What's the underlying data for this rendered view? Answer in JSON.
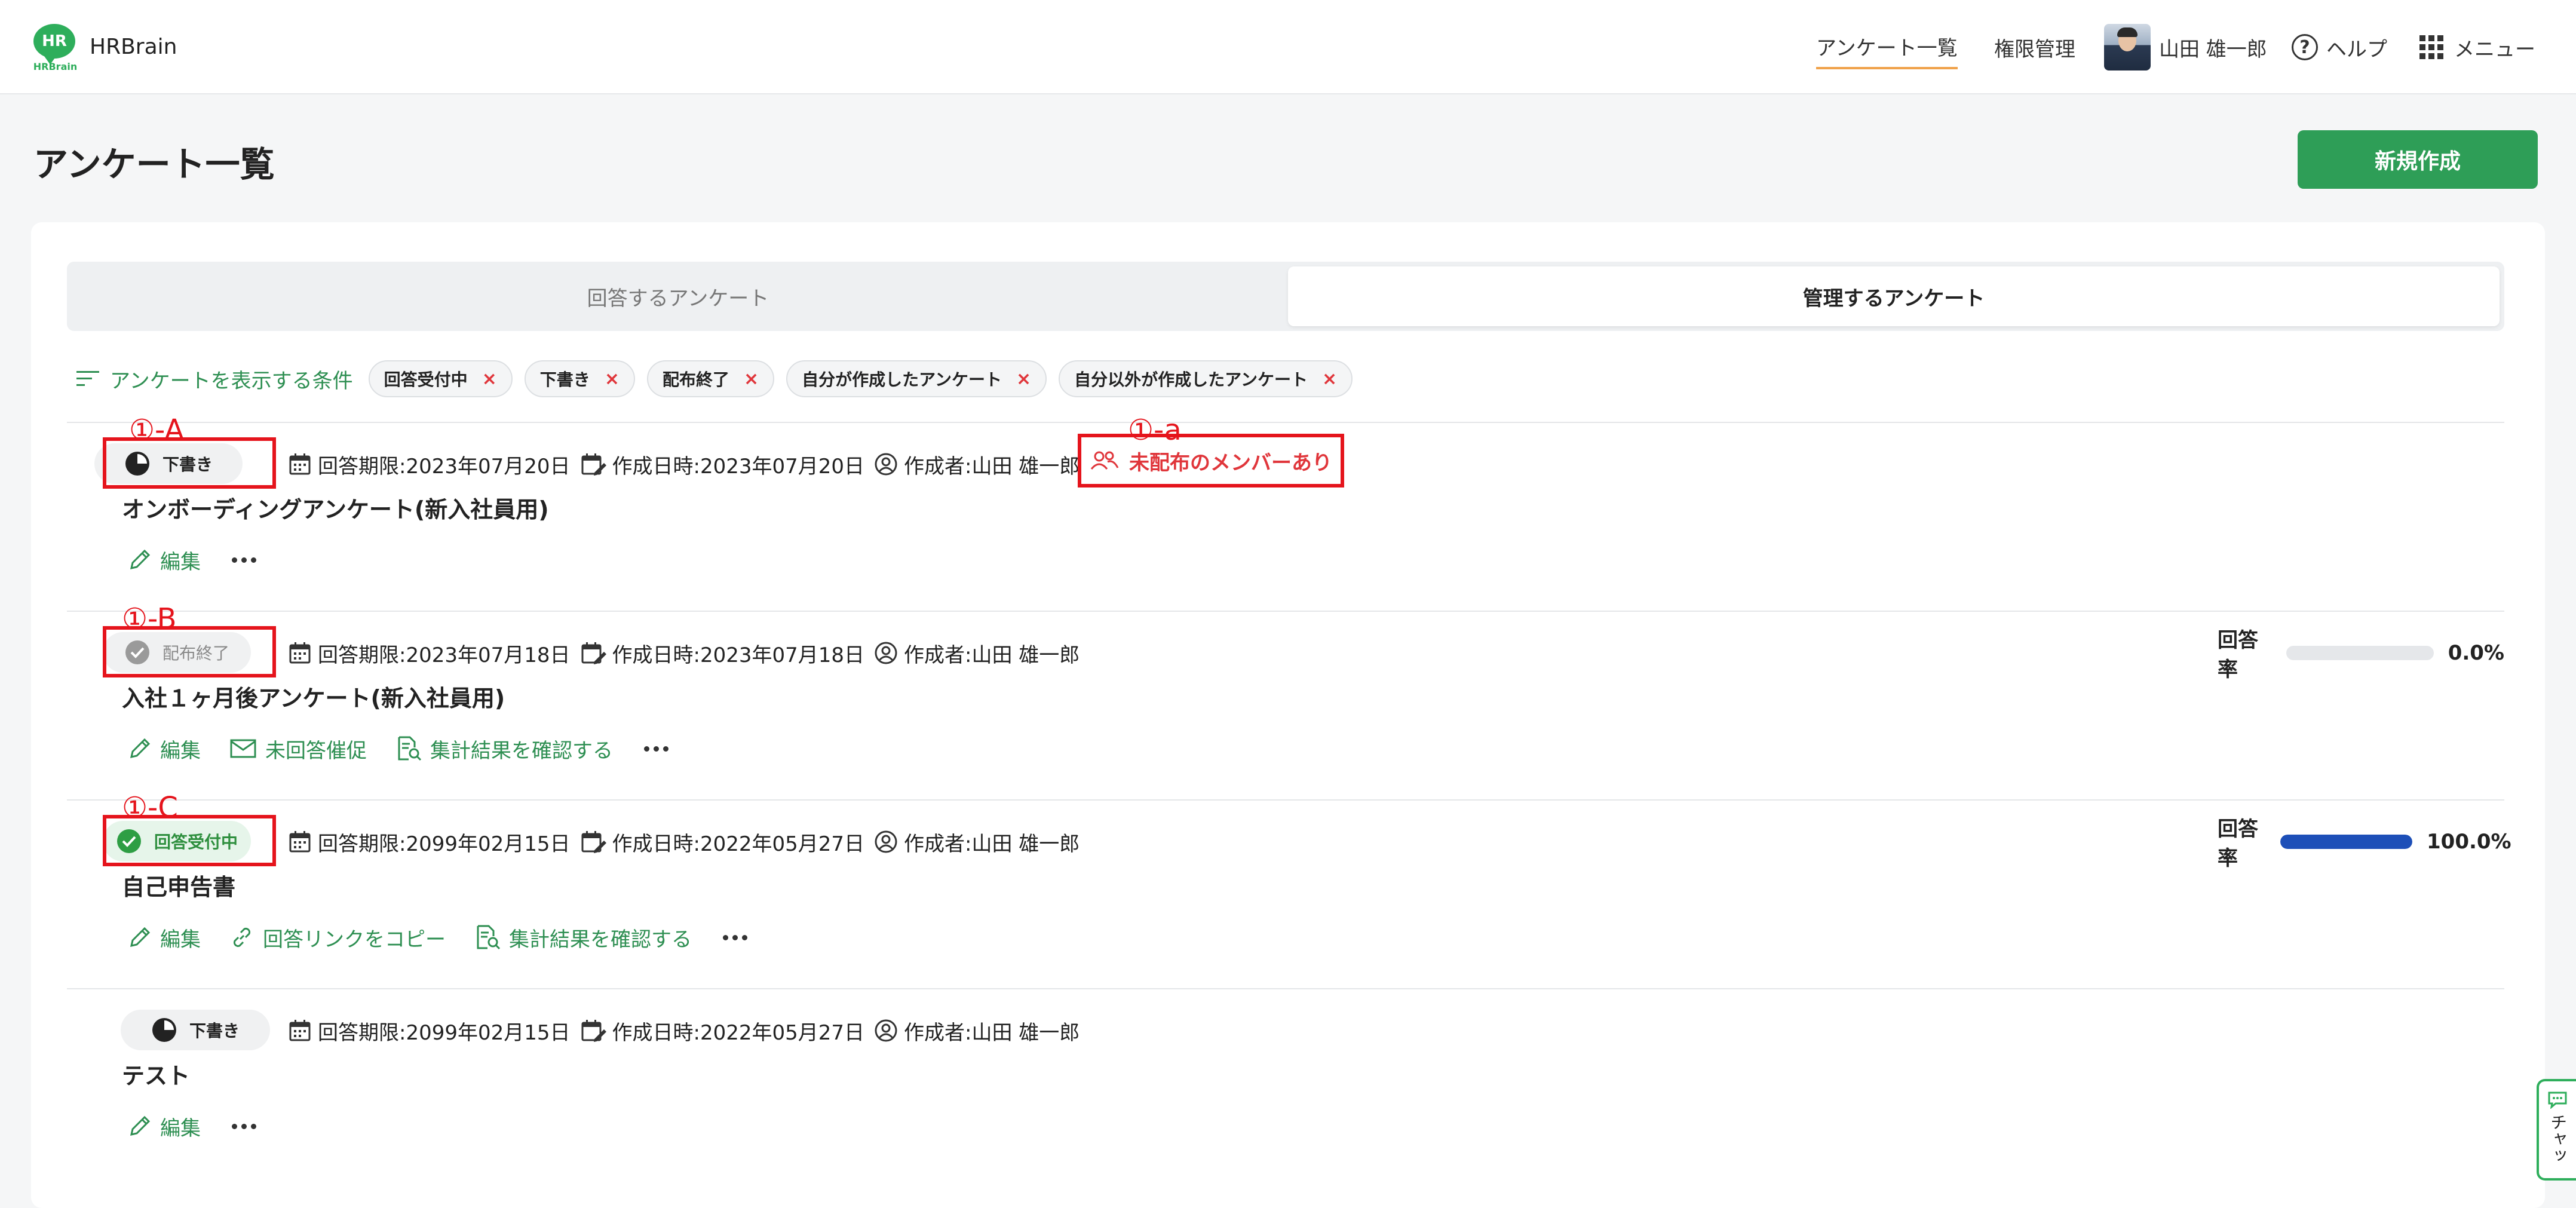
{
  "header": {
    "logo_text": "HR",
    "logo_sub": "HRBrain",
    "brand": "HRBrain",
    "nav": {
      "survey_list": "アンケート一覧",
      "permissions": "権限管理",
      "user_name": "山田 雄一郎",
      "help": "ヘルプ",
      "menu": "メニュー"
    },
    "accent_color": "#f0a24b"
  },
  "page": {
    "title": "アンケート一覧",
    "new_button": "新規作成",
    "primary_color": "#2e9e57"
  },
  "tabs": {
    "answer": "回答するアンケート",
    "manage": "管理するアンケート",
    "active": "manage"
  },
  "filters": {
    "label": "アンケートを表示する条件",
    "chips": [
      "回答受付中",
      "下書き",
      "配布終了",
      "自分が作成したアンケート",
      "自分以外が作成したアンケート"
    ],
    "remove_symbol": "×"
  },
  "annotations": {
    "a_upper": "①-A",
    "a_lower": "①-a",
    "b": "①-B",
    "c": "①-C"
  },
  "surveys": [
    {
      "status": "下書き",
      "deadline": "回答期限:2023年07月20日",
      "created": "作成日時:2023年07月20日",
      "author": "作成者:山田 雄一郎",
      "unassigned": "未配布のメンバーあり",
      "title": "オンボーディングアンケート(新入社員用)",
      "actions": {
        "edit": "編集"
      }
    },
    {
      "status": "配布終了",
      "deadline": "回答期限:2023年07月18日",
      "created": "作成日時:2023年07月18日",
      "author": "作成者:山田 雄一郎",
      "title": "入社１ヶ月後アンケート(新入社員用)",
      "actions": {
        "edit": "編集",
        "remind": "未回答催促",
        "results": "集計結果を確認する"
      },
      "rate_label": "回答率",
      "rate_value": "0.0%",
      "rate_fraction": 0.0
    },
    {
      "status": "回答受付中",
      "deadline": "回答期限:2099年02月15日",
      "created": "作成日時:2022年05月27日",
      "author": "作成者:山田 雄一郎",
      "title": "自己申告書",
      "actions": {
        "edit": "編集",
        "copy_link": "回答リンクをコピー",
        "results": "集計結果を確認する"
      },
      "rate_label": "回答率",
      "rate_value": "100.0%",
      "rate_fraction": 1.0
    },
    {
      "status": "下書き",
      "deadline": "回答期限:2099年02月15日",
      "created": "作成日時:2022年05月27日",
      "author": "作成者:山田 雄一郎",
      "title": "テスト",
      "actions": {
        "edit": "編集"
      }
    }
  ],
  "chat": {
    "label": "チャッ"
  }
}
